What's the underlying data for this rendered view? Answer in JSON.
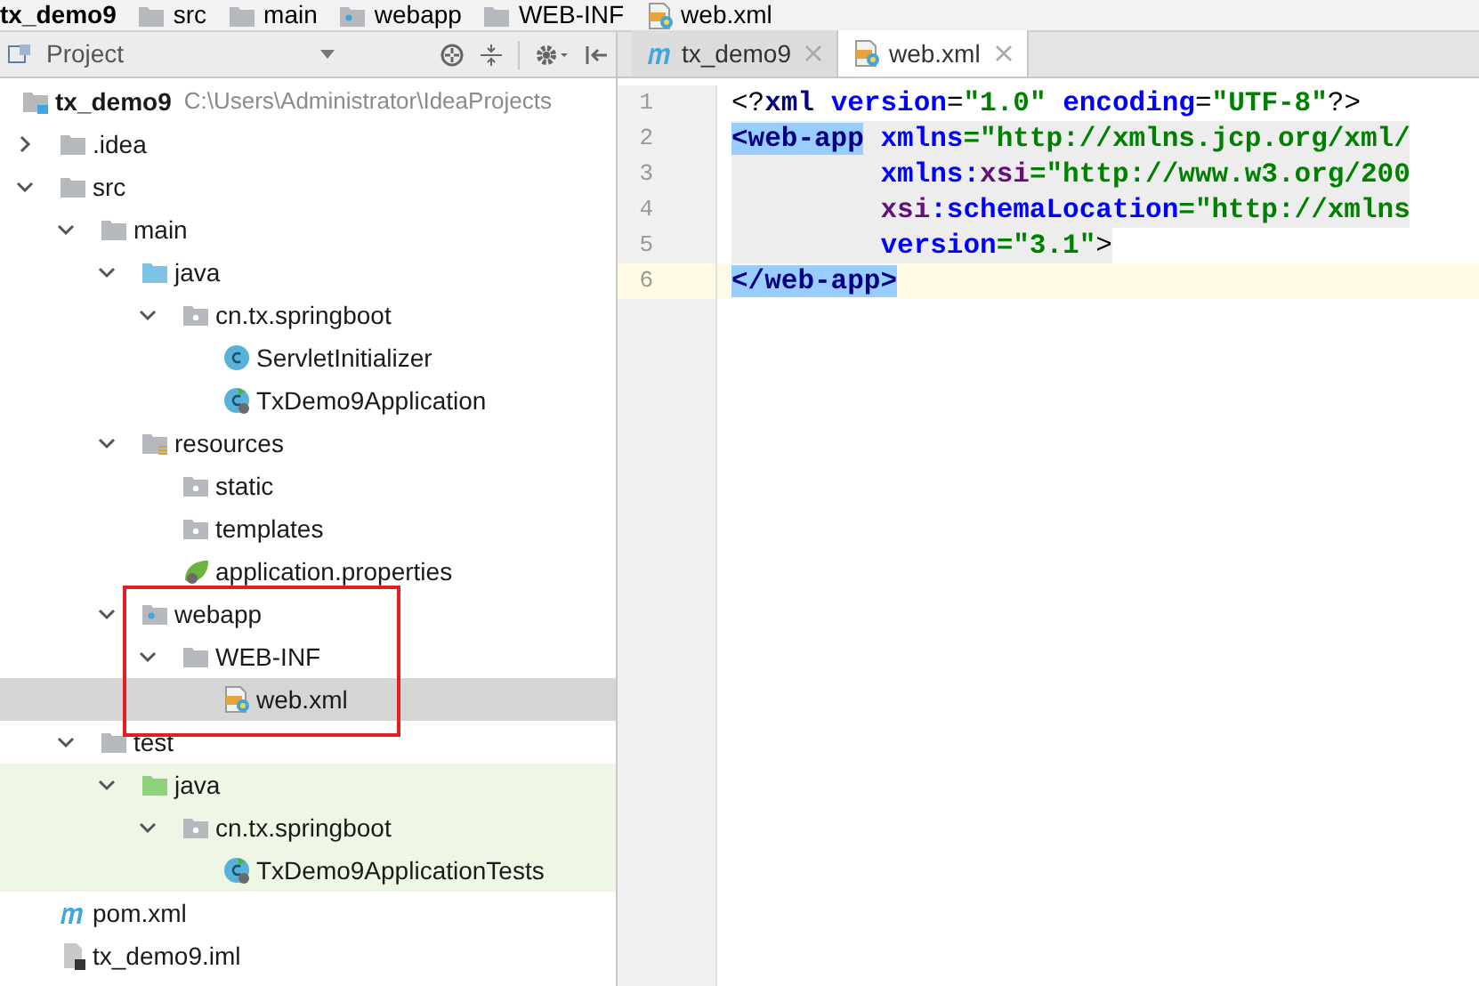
{
  "breadcrumb": [
    {
      "label": "tx_demo9",
      "kind": "module"
    },
    {
      "label": "src",
      "kind": "folder"
    },
    {
      "label": "main",
      "kind": "folder"
    },
    {
      "label": "webapp",
      "kind": "web"
    },
    {
      "label": "WEB-INF",
      "kind": "folder"
    },
    {
      "label": "web.xml",
      "kind": "xml"
    }
  ],
  "project_panel": {
    "title": "Project"
  },
  "tree": [
    {
      "label": "tx_demo9",
      "path": "C:\\Users\\Administrator\\IdeaProjects",
      "kind": "module",
      "selected": false,
      "highlighted": false,
      "children": [
        {
          "label": ".idea",
          "kind": "folder",
          "expanded": false,
          "selected": false,
          "highlighted": false
        },
        {
          "label": "src",
          "kind": "folder",
          "expanded": true,
          "selected": false,
          "highlighted": false,
          "children": [
            {
              "label": "main",
              "kind": "folder",
              "expanded": true,
              "selected": false,
              "highlighted": false,
              "children": [
                {
                  "label": "java",
                  "kind": "source",
                  "expanded": true,
                  "selected": false,
                  "highlighted": false,
                  "children": [
                    {
                      "label": "cn.tx.springboot",
                      "kind": "package",
                      "expanded": true,
                      "selected": false,
                      "highlighted": false,
                      "children": [
                        {
                          "label": "ServletInitializer",
                          "kind": "class",
                          "selected": false,
                          "highlighted": false
                        },
                        {
                          "label": "TxDemo9Application",
                          "kind": "spring_class",
                          "selected": false,
                          "highlighted": false
                        }
                      ]
                    }
                  ]
                },
                {
                  "label": "resources",
                  "kind": "resources",
                  "expanded": true,
                  "selected": false,
                  "highlighted": false,
                  "children": [
                    {
                      "label": "static",
                      "kind": "package",
                      "selected": false,
                      "highlighted": false
                    },
                    {
                      "label": "templates",
                      "kind": "package",
                      "selected": false,
                      "highlighted": false
                    },
                    {
                      "label": "application.properties",
                      "kind": "properties",
                      "selected": false,
                      "highlighted": false
                    }
                  ]
                },
                {
                  "label": "webapp",
                  "kind": "web",
                  "expanded": true,
                  "selected": false,
                  "highlighted": false,
                  "children": [
                    {
                      "label": "WEB-INF",
                      "kind": "folder",
                      "expanded": true,
                      "selected": false,
                      "highlighted": false,
                      "children": [
                        {
                          "label": "web.xml",
                          "kind": "xml",
                          "selected": true,
                          "highlighted": false
                        }
                      ]
                    }
                  ]
                }
              ]
            },
            {
              "label": "test",
              "kind": "folder",
              "expanded": true,
              "selected": false,
              "highlighted": false,
              "children": [
                {
                  "label": "java",
                  "kind": "test_source",
                  "expanded": true,
                  "selected": false,
                  "highlighted": true,
                  "children": [
                    {
                      "label": "cn.tx.springboot",
                      "kind": "package",
                      "expanded": true,
                      "selected": false,
                      "highlighted": true,
                      "children": [
                        {
                          "label": "TxDemo9ApplicationTests",
                          "kind": "spring_class",
                          "selected": false,
                          "highlighted": true
                        }
                      ]
                    }
                  ]
                }
              ]
            }
          ]
        },
        {
          "label": "pom.xml",
          "kind": "maven",
          "selected": false,
          "highlighted": false
        },
        {
          "label": "tx_demo9.iml",
          "kind": "iml",
          "selected": false,
          "highlighted": false
        }
      ]
    }
  ],
  "tabs": [
    {
      "label": "tx_demo9",
      "kind": "maven",
      "selected": false
    },
    {
      "label": "web.xml",
      "kind": "xml",
      "selected": true
    }
  ],
  "code": [
    {
      "number": "1",
      "scoped": false,
      "current": false,
      "tokens": [
        {
          "kind": "punct",
          "text": "<?"
        },
        {
          "kind": "tag",
          "text": "xml"
        },
        {
          "kind": "attr",
          "text": " version"
        },
        {
          "kind": "punct",
          "text": "="
        },
        {
          "kind": "value",
          "text": "\"1.0\""
        },
        {
          "kind": "attr",
          "text": " encoding"
        },
        {
          "kind": "punct",
          "text": "="
        },
        {
          "kind": "value",
          "text": "\"UTF-8\""
        },
        {
          "kind": "punct",
          "text": "?>"
        }
      ]
    },
    {
      "number": "2",
      "scoped": true,
      "current": false,
      "tokens": [
        {
          "kind": "matched",
          "text": "<web-app"
        },
        {
          "kind": "attr",
          "text": " xmlns"
        },
        {
          "kind": "value",
          "text": "=\"http://xmlns.jcp.org/xml/"
        }
      ]
    },
    {
      "number": "3",
      "scoped": true,
      "current": false,
      "tokens": [
        {
          "kind": "attr",
          "text": "         xmlns:"
        },
        {
          "kind": "ns",
          "text": "xsi"
        },
        {
          "kind": "value",
          "text": "=\"http://www.w3.org/200"
        }
      ]
    },
    {
      "number": "4",
      "scoped": true,
      "current": false,
      "tokens": [
        {
          "kind": "ns",
          "text": "         xsi"
        },
        {
          "kind": "attr",
          "text": ":schemaLocation"
        },
        {
          "kind": "value",
          "text": "=\"http://xmlns"
        }
      ]
    },
    {
      "number": "5",
      "scoped": true,
      "current": false,
      "tokens": [
        {
          "kind": "attr",
          "text": "         version"
        },
        {
          "kind": "value",
          "text": "=\"3.1\""
        },
        {
          "kind": "punct",
          "text": ">"
        }
      ]
    },
    {
      "number": "6",
      "scoped": false,
      "current": true,
      "tokens": [
        {
          "kind": "matched",
          "text": "</web-app>"
        }
      ]
    }
  ]
}
